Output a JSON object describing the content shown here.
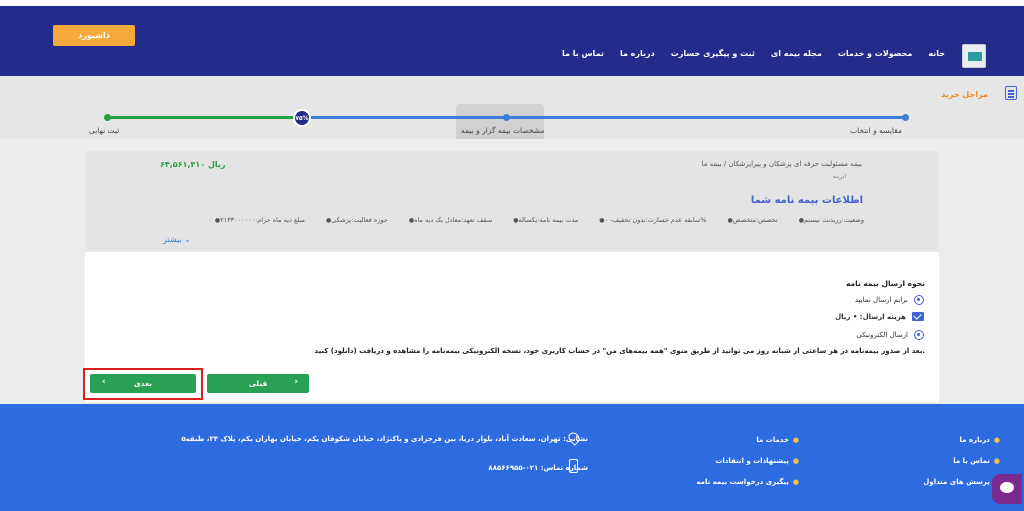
{
  "header": {
    "dashboard_label": "داشبورد",
    "nav": [
      "خانه",
      "محصولات و خدمات",
      "مجله بیمه ای",
      "ثبت و پیگیری خسارت",
      "درباره ما",
      "تماس با ما"
    ]
  },
  "steps": {
    "title": "مراحل خرید",
    "progress_label": "۷۵%",
    "progress_fraction": 0.75,
    "labels": [
      "مقایسه و انتخاب",
      "مشخصات بیمه گزار و بیمه",
      "ثبت نهایی"
    ]
  },
  "info": {
    "breadcrumb": "بیمه مسئولیت حرفه ای پزشکان و پیراپزشکان  /  بیمه ما",
    "sub": "ایرینه",
    "price": "۶۴,۵۶۱,۳۱۰ ریال",
    "title": "اطلاعات بیمه نامه شما",
    "chips": [
      "وضعیت:رزیدنت نیستم",
      "تخصص:متخصص",
      "سابقه عدم خسارت:بدون تخفیف- ۰%",
      "مدت بیمه نامه:یکساله",
      "سقف تعهد:معادل یک دیه ماه",
      "حوزه فعالیت:پزشکی",
      "مبلغ دیه ماه حرام:۲۱۳۳۰۰۰۰۰۰"
    ],
    "more_label": "بیشتر"
  },
  "delivery": {
    "title": "نحوه ارسال بیمه نامه",
    "options": [
      "برایم ارسال نمایید",
      "ارسال الکترونیکی"
    ],
    "cost_label": "هزینه ارسال: • ریال",
    "note": "بعد از صدور بیمه‌نامه در هر ساعتی از شبانه روز می توانید از طریق منوی \"همه بیمه‌های من\" در حساب کاربری خود، نسخه الکترونیکی بیمه‌نامه را مشاهده و دریافت (دانلود) کنید."
  },
  "buttons": {
    "prev_label": "قبلی",
    "next_label": "بعدی"
  },
  "footer": {
    "col1": [
      "درباره ما",
      "تماس با ما",
      "پرسش های متداول"
    ],
    "col2": [
      "خدمات ما",
      "پیشنهادات و انتقادات",
      "پیگیری درخواست بیمه نامه"
    ],
    "address": "نشانی: تهران، سعادت آباد، بلوار دریا، بین فرحزادی و پاکنژاد، خیابان شکوفان یکم، خیابان بهاران یکم، پلاک ۳۴، طبقه۵",
    "phone": "شماره تماس: ۰۲۱-۸۸۵۶۶۹۵۵"
  }
}
